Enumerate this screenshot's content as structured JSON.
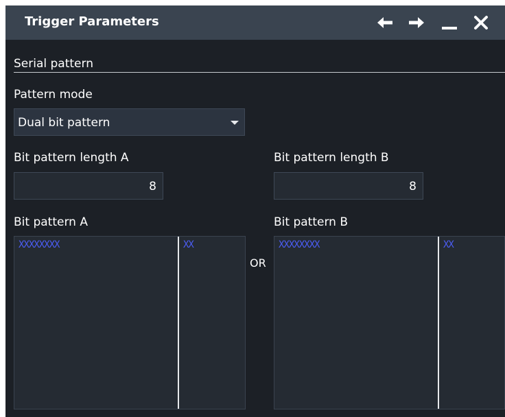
{
  "window": {
    "title": "Trigger Parameters"
  },
  "titlebar": {
    "icons": [
      "arrow-left-icon",
      "arrow-right-icon",
      "minimize-icon",
      "close-icon"
    ]
  },
  "section": {
    "title": "Serial pattern"
  },
  "pattern_mode": {
    "label": "Pattern mode",
    "value": "Dual bit pattern"
  },
  "length_a": {
    "label": "Bit pattern length A",
    "value": "8"
  },
  "length_b": {
    "label": "Bit pattern length B",
    "value": "8"
  },
  "pattern_a": {
    "label": "Bit pattern A",
    "main": "XXXXXXXX",
    "extra": "XX"
  },
  "pattern_b": {
    "label": "Bit pattern B",
    "main": "XXXXXXXX",
    "extra": "XX"
  },
  "or_label": "OR",
  "colors": {
    "titlebar": "#3a4450",
    "background": "#1c2026",
    "field": "#2c3440",
    "pattern_text": "#4b5cf2"
  }
}
